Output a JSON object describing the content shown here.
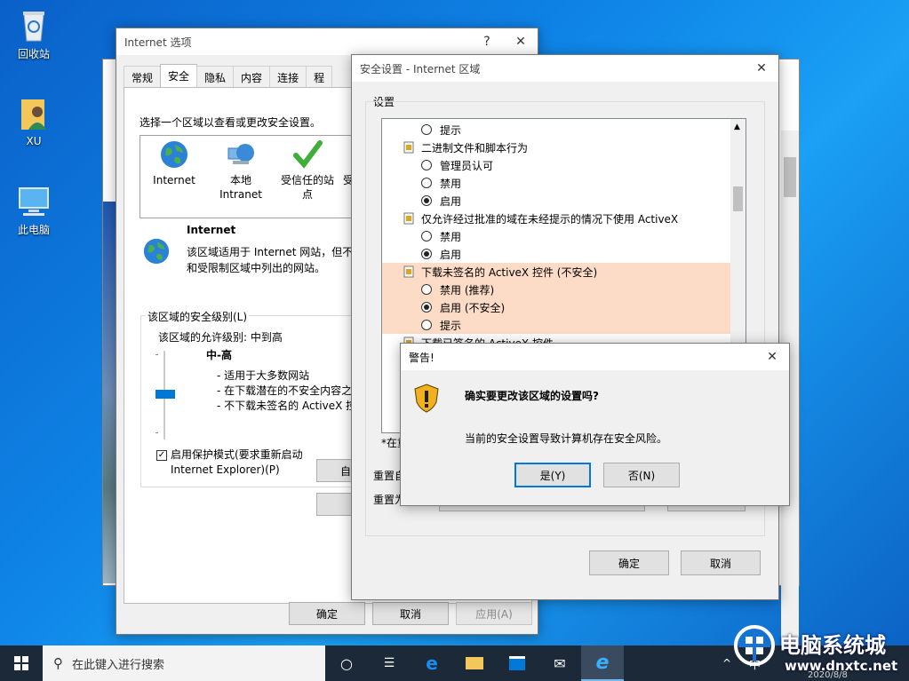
{
  "desktop": {
    "icons": [
      {
        "label": "回收站"
      },
      {
        "label": "XU"
      },
      {
        "label": "此电脑"
      }
    ]
  },
  "internet_options": {
    "title": "Internet 选项",
    "help": "?",
    "close": "✕",
    "tabs": [
      "常规",
      "安全",
      "隐私",
      "内容",
      "连接",
      "程"
    ],
    "active_tab": "安全",
    "zone_prompt": "选择一个区域以查看或更改安全设置。",
    "zones": [
      {
        "label": "Internet"
      },
      {
        "label": "本地\nIntranet"
      },
      {
        "label": "受信任的站\n点"
      },
      {
        "label": "受"
      }
    ],
    "zone_name": "Internet",
    "zone_desc_line1": "该区域适用于 Internet 网站，但不",
    "zone_desc_line2": "和受限制区域中列出的网站。",
    "level_group_label": "该区域的安全级别(L)",
    "allowed_level": "该区域的允许级别: 中到高",
    "level_name": "中-高",
    "level_items": [
      "- 适用于大多数网站",
      "- 在下载潜在的不安全内容之",
      "- 不下载未签名的 ActiveX 控"
    ],
    "protected_mode_line1": "启用保护模式(要求重新启动",
    "protected_mode_line2": "Internet Explorer)(P)",
    "custom_btn": "自定义",
    "default_btn": "将",
    "ok": "确定",
    "cancel": "取消",
    "apply": "应用(A)"
  },
  "security_settings": {
    "title": "安全设置 - Internet 区域",
    "close": "✕",
    "settings_label": "设置",
    "rows": [
      {
        "type": "radio",
        "label": "提示",
        "checked": false,
        "highlight": false
      },
      {
        "type": "group",
        "label": "二进制文件和脚本行为",
        "highlight": false
      },
      {
        "type": "radio",
        "label": "管理员认可",
        "checked": false,
        "highlight": false
      },
      {
        "type": "radio",
        "label": "禁用",
        "checked": false,
        "highlight": false
      },
      {
        "type": "radio",
        "label": "启用",
        "checked": true,
        "highlight": false
      },
      {
        "type": "group",
        "label": "仅允许经过批准的域在未经提示的情况下使用 ActiveX",
        "highlight": false
      },
      {
        "type": "radio",
        "label": "禁用",
        "checked": false,
        "highlight": false
      },
      {
        "type": "radio",
        "label": "启用",
        "checked": true,
        "highlight": false
      },
      {
        "type": "group",
        "label": "下载未签名的 ActiveX 控件 (不安全)",
        "highlight": true
      },
      {
        "type": "radio",
        "label": "禁用 (推荐)",
        "checked": false,
        "highlight": true
      },
      {
        "type": "radio",
        "label": "启用 (不安全)",
        "checked": true,
        "highlight": true
      },
      {
        "type": "radio",
        "label": "提示",
        "checked": false,
        "highlight": true
      },
      {
        "type": "group",
        "label": "下载已签名的 ActiveX 控件",
        "highlight": false
      }
    ],
    "footnote": "*在重",
    "reset_label": "重置自",
    "reset_to_label": "重置为",
    "ok": "确定",
    "cancel": "取消"
  },
  "warning": {
    "title": "警告!",
    "close": "✕",
    "question": "确实要更改该区域的设置吗?",
    "detail": "当前的安全设置导致计算机存在安全风险。",
    "yes": "是(Y)",
    "no": "否(N)"
  },
  "taskbar": {
    "search_placeholder": "在此键入进行搜索",
    "tray_ime": "中"
  },
  "watermark": {
    "brand": "电脑系统城",
    "url": "www.dnxtc.net",
    "date": "2020/8/8"
  }
}
